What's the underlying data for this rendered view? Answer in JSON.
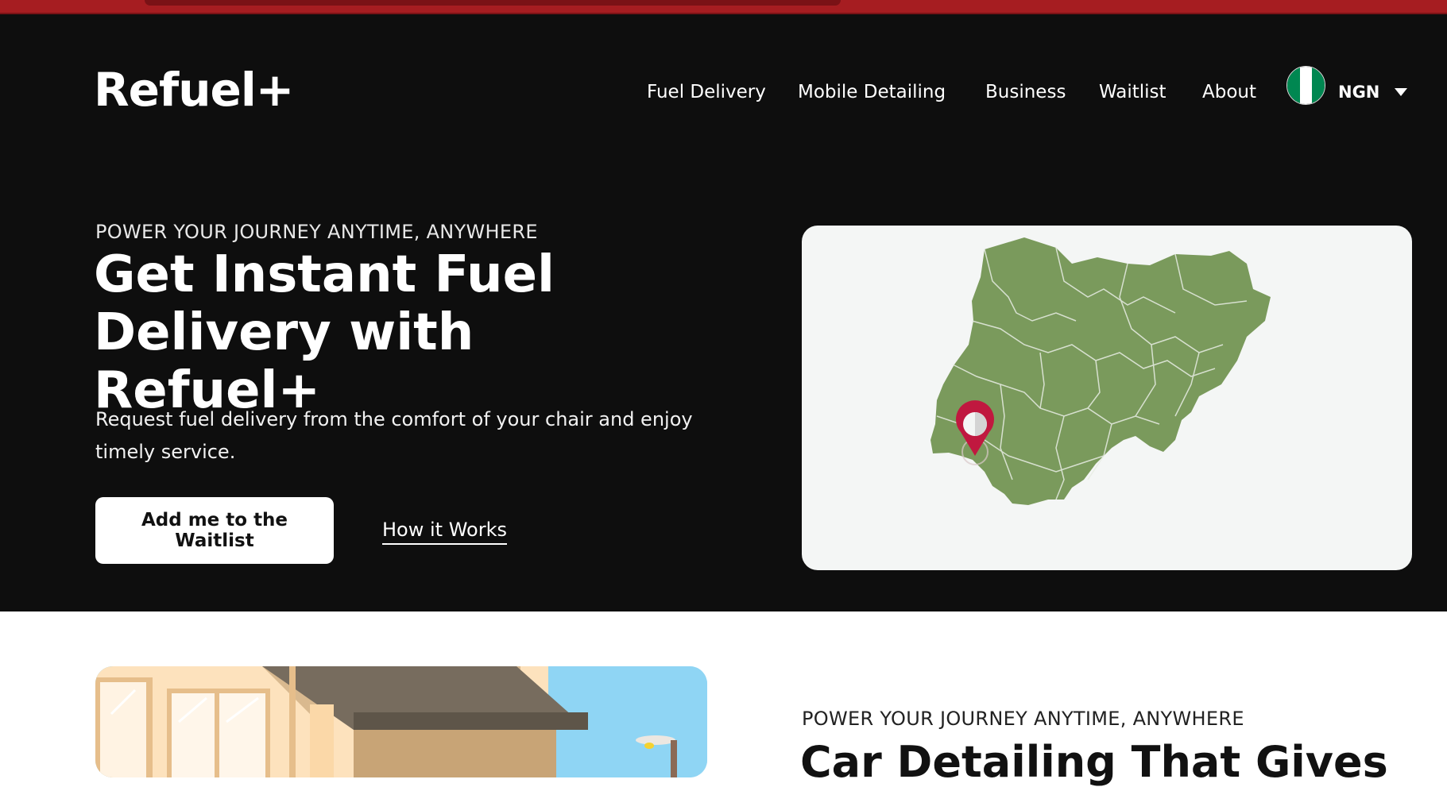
{
  "brand": {
    "logo_text": "Refuel+"
  },
  "nav": {
    "items": [
      {
        "label": "Fuel Delivery"
      },
      {
        "label": "Mobile Detailing"
      },
      {
        "label": "Business"
      },
      {
        "label": "Waitlist"
      },
      {
        "label": "About"
      }
    ],
    "currency": "NGN",
    "flag_icon": "nigeria-flag-icon"
  },
  "hero": {
    "eyebrow": "POWER YOUR JOURNEY ANYTIME, ANYWHERE",
    "title": "Get Instant Fuel Delivery with Refuel+",
    "subtitle": "Request fuel delivery from the comfort of your chair and enjoy timely service.",
    "primary_cta": "Add me to the Waitlist",
    "secondary_cta": "How it Works",
    "map_icon": "location-pin-icon"
  },
  "section2": {
    "eyebrow": "POWER YOUR JOURNEY ANYTIME, ANYWHERE",
    "title": "Car Detailing That Gives"
  },
  "colors": {
    "brand_red": "#a61d21",
    "hero_bg": "#0e0e0e",
    "map_green": "#7a9a5c",
    "pin_red": "#c0183f"
  }
}
